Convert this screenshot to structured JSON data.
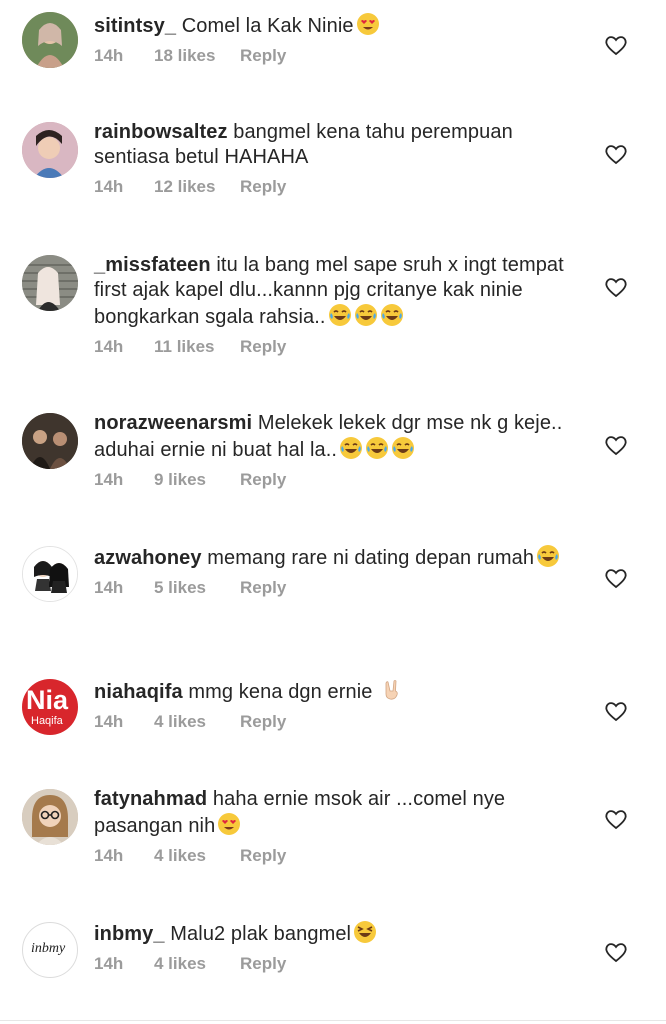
{
  "comments": [
    {
      "username": "sitintsy_",
      "text": "Comel la Kak Ninie",
      "emoji": [
        "heart-eyes"
      ],
      "time": "14h",
      "likes": "18 likes",
      "reply": "Reply",
      "avatar_color": "#b89a7e"
    },
    {
      "username": "rainbowsaltez",
      "text": "bangmel kena tahu perempuan sentiasa betul HAHAHA",
      "emoji": [],
      "time": "14h",
      "likes": "12 likes",
      "reply": "Reply",
      "avatar_color": "#c9a3a4"
    },
    {
      "username": "_missfateen",
      "text": "itu la bang mel sape sruh x ingt tempat first ajak kapel dlu...kannn pjg critanye kak ninie bongkarkan sgala rahsia..",
      "emoji": [
        "laugh",
        "laugh",
        "laugh"
      ],
      "time": "14h",
      "likes": "11 likes",
      "reply": "Reply",
      "avatar_color": "#9c9c94"
    },
    {
      "username": "norazweenarsmi",
      "text": "Melekek lekek dgr mse nk g keje.. aduhai ernie ni buat hal la..",
      "emoji": [
        "laugh",
        "laugh",
        "laugh"
      ],
      "time": "14h",
      "likes": "9 likes",
      "reply": "Reply",
      "avatar_color": "#5a4c40"
    },
    {
      "username": "azwahoney",
      "text": "memang rare ni dating depan rumah",
      "emoji": [
        "laugh"
      ],
      "time": "14h",
      "likes": "5 likes",
      "reply": "Reply",
      "avatar_color": "#ffffff"
    },
    {
      "username": "niahaqifa",
      "text": "mmg kena dgn ernie",
      "emoji": [
        "victory"
      ],
      "time": "14h",
      "likes": "4 likes",
      "reply": "Reply",
      "avatar_color": "#d8262c",
      "avatar_text": "Nia",
      "avatar_subtext": "Haqifa"
    },
    {
      "username": "fatynahmad",
      "text": "haha ernie msok air ...comel nye pasangan nih",
      "emoji": [
        "heart-eyes"
      ],
      "time": "14h",
      "likes": "4 likes",
      "reply": "Reply",
      "avatar_color": "#c7b5a2"
    },
    {
      "username": "inbmy_",
      "text": "Malu2 plak bangmel",
      "emoji": [
        "grin-squint"
      ],
      "time": "14h",
      "likes": "4 likes",
      "reply": "Reply",
      "avatar_color": "#ffffff",
      "avatar_text": "inbmy"
    }
  ],
  "icons": {
    "like": "heart-outline-icon"
  },
  "colors": {
    "meta_text": "#9b9b9b",
    "text": "#262626",
    "emoji_face": "#f7c93b"
  }
}
